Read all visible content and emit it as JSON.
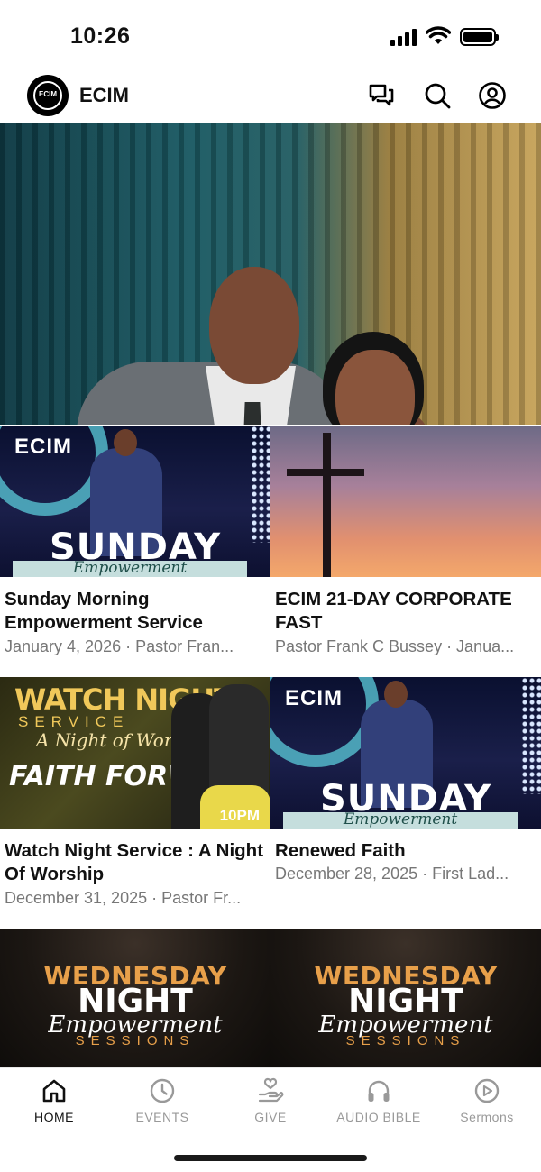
{
  "status_bar": {
    "time": "10:26"
  },
  "header": {
    "logo_text": "ECIM",
    "app_name": "ECIM",
    "icons": [
      "chat-icon",
      "search-icon",
      "profile-icon"
    ]
  },
  "hero": {
    "image": "pastor-and-first-lady-photo"
  },
  "cards": [
    {
      "title": "Sunday Morning Empowerment Service",
      "meta": "January 4, 2026 · Pastor Fran...",
      "thumb": {
        "brand": "ECIM",
        "headline": "SUNDAY",
        "script": "Empowerment"
      }
    },
    {
      "title": "ECIM 21-DAY CORPORATE FAST",
      "meta": "Pastor Frank C Bussey · Janua...",
      "thumb": {
        "image": "cross-at-sunset"
      }
    },
    {
      "title": "Watch Night Service : A Night Of Worship",
      "meta": "December 31, 2025 · Pastor Fr...",
      "thumb": {
        "line1": "WATCH NIGHT",
        "line2": "SERVICE",
        "line3": "A Night of Worship",
        "line4": "FAITH FORWARD",
        "time": "10PM"
      }
    },
    {
      "title": "Renewed Faith",
      "meta": "December 28, 2025 · First Lad...",
      "thumb": {
        "brand": "ECIM",
        "headline": "SUNDAY",
        "script": "Empowerment"
      }
    },
    {
      "thumb": {
        "line1": "WEDNESDAY",
        "line2": "NIGHT",
        "line3": "Empowerment",
        "line4": "SESSIONS"
      }
    },
    {
      "thumb": {
        "line1": "WEDNESDAY",
        "line2": "NIGHT",
        "line3": "Empowerment",
        "line4": "SESSIONS"
      }
    }
  ],
  "tabbar": {
    "active": "HOME",
    "tabs": [
      {
        "label": "HOME",
        "icon": "home-icon"
      },
      {
        "label": "EVENTS",
        "icon": "clock-icon"
      },
      {
        "label": "GIVE",
        "icon": "give-hand-icon"
      },
      {
        "label": "AUDIO BIBLE",
        "icon": "headphones-icon"
      },
      {
        "label": "Sermons",
        "icon": "play-circle-icon"
      }
    ]
  },
  "colors": {
    "accent": "#111111",
    "inactive": "#999999",
    "meta_text": "#777777"
  }
}
